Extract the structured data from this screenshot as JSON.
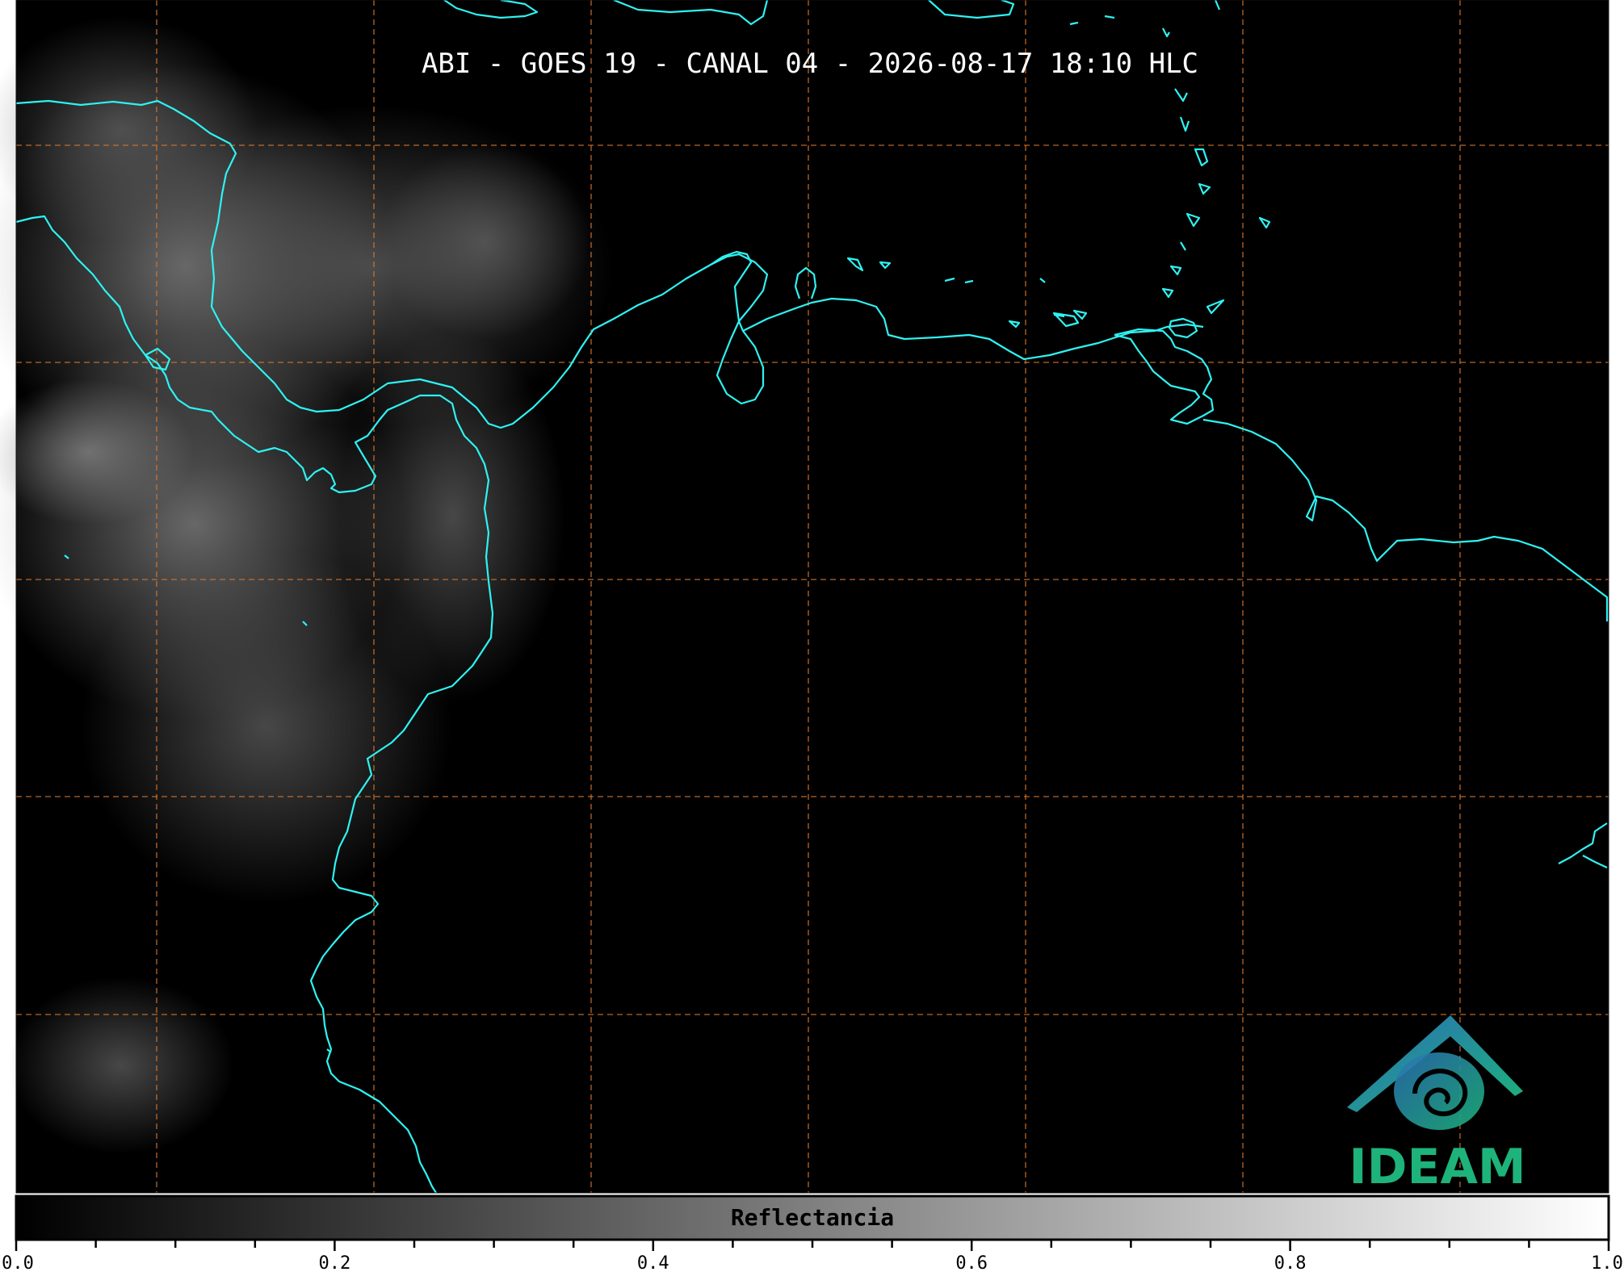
{
  "map": {
    "title": "ABI - GOES 19 - CANAL 04 - 2026-08-17 18:10 HLC",
    "coastline_color": "#2ff2f2",
    "grid_color": "#d9782e",
    "background_color": "#000000"
  },
  "colorbar": {
    "label": "Reflectancia",
    "range": [
      0.0,
      1.0
    ],
    "tick_labels": [
      "0.0",
      "0.2",
      "0.4",
      "0.6",
      "0.8",
      "1.0"
    ],
    "colormap": "grayscale black-to-white"
  },
  "logo": {
    "text": "IDEAM",
    "text_color": "#1db37a",
    "icon": "ideam-swirl-logo"
  }
}
